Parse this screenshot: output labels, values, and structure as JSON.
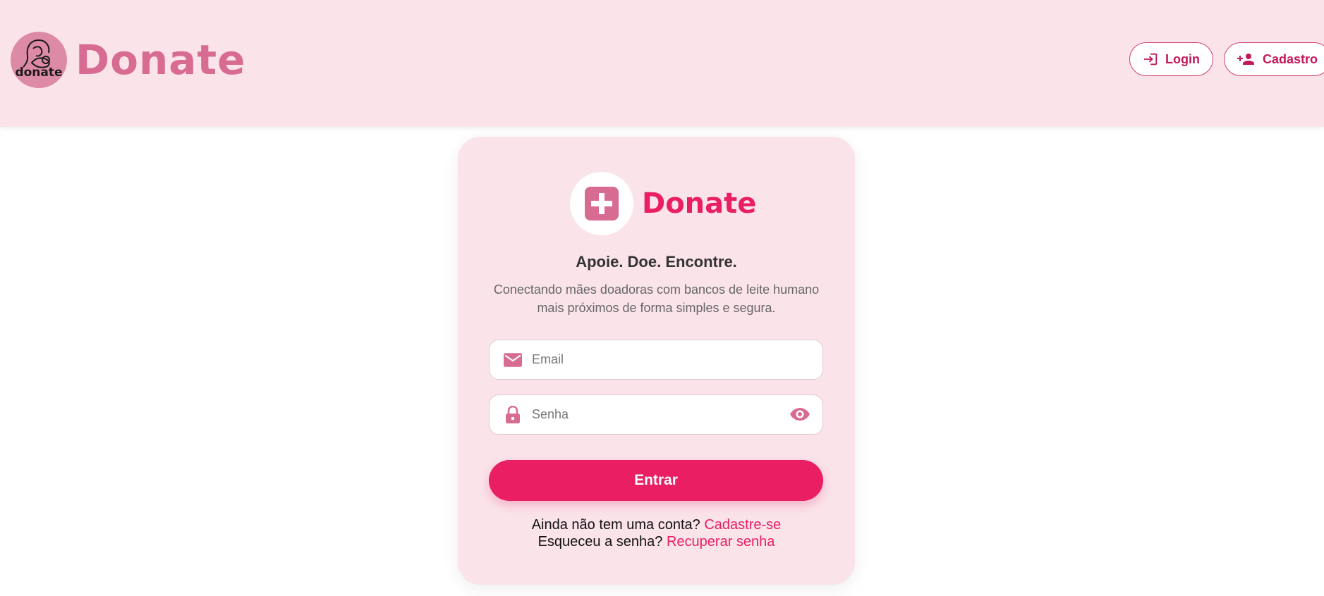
{
  "header": {
    "logo_text": "donate",
    "brand_name": "Donate",
    "login_label": "Login",
    "signup_label": "Cadastro"
  },
  "card": {
    "brand_name": "Donate",
    "tagline": "Apoie. Doe. Encontre.",
    "description": "Conectando mães doadoras com bancos de leite humano mais próximos de forma simples e segura.",
    "email_placeholder": "Email",
    "password_placeholder": "Senha",
    "submit_label": "Entrar",
    "no_account_text": "Ainda não tem uma conta?",
    "signup_link": "Cadastre-se",
    "forgot_text": "Esqueceu a senha?",
    "recover_link": "Recuperar senha"
  },
  "icons": {
    "login": "login-icon",
    "signup": "person-add-icon",
    "card_logo": "medical-cross-icon",
    "email": "mail-icon",
    "password": "lock-icon",
    "toggle_password": "eye-icon"
  },
  "colors": {
    "primary": "#e91e63",
    "brand_pink": "#d86b92",
    "header_bg": "#fbe3ea",
    "card_bg": "#fbe3ea",
    "link_text": "#c2185b"
  }
}
